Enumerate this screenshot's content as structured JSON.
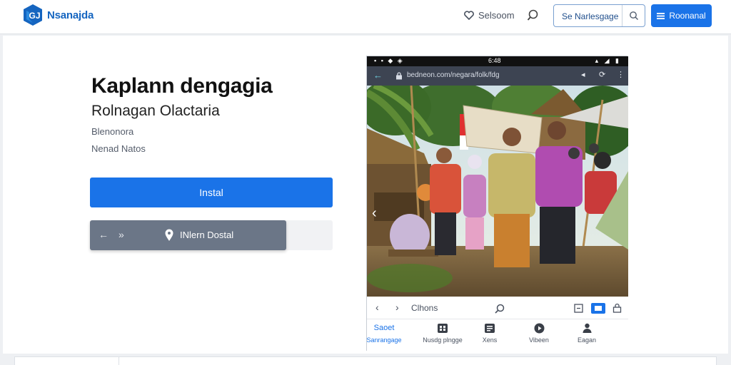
{
  "header": {
    "brand": "Nsanajda",
    "link_label": "Selsoom",
    "search_label": "Se Narlesgage",
    "primary_button": "Roonanal"
  },
  "hero": {
    "title": "Kaplann dengagia",
    "subtitle": "Rolnagan Olactaria",
    "meta_line_1": "Blenonora",
    "meta_line_2": "Nenad Natos",
    "install_label": "Instal",
    "secondary_label": "INlern Dostal"
  },
  "phone": {
    "status_time": "6:48",
    "url": "bedneon.com/negara/folk/fdg",
    "pager_label": "Clhons",
    "tabs": [
      {
        "label": "Sanrangage",
        "icon": "Saoet"
      },
      {
        "label": "Nusdg plngge",
        "icon": "grid-icon"
      },
      {
        "label": "Xens",
        "icon": "doc-icon"
      },
      {
        "label": "Vibeen",
        "icon": "play-icon"
      },
      {
        "label": "Eagan",
        "icon": "person-icon"
      }
    ]
  },
  "colors": {
    "accent": "#1a73e8",
    "brand": "#1565c0",
    "secondary_button": "#6b7687"
  }
}
